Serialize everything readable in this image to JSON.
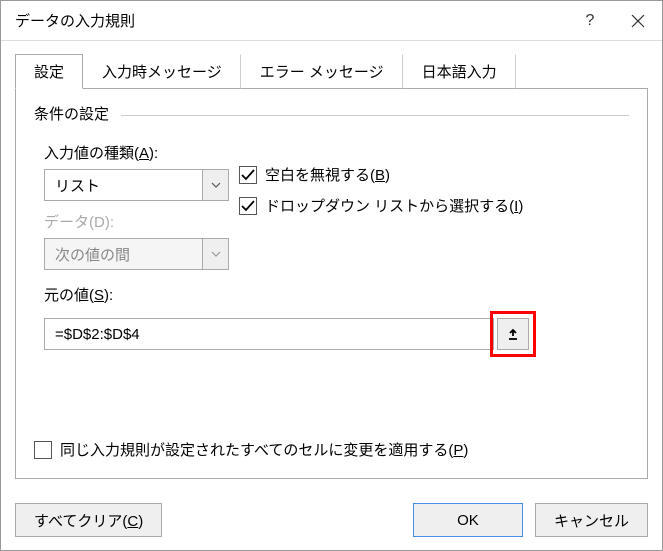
{
  "titlebar": {
    "title": "データの入力規則"
  },
  "tabs": {
    "settings": "設定",
    "input_msg": "入力時メッセージ",
    "error_msg": "エラー メッセージ",
    "ime": "日本語入力"
  },
  "fieldset": {
    "legend": "条件の設定"
  },
  "allow": {
    "label_pre": "入力値の種類(",
    "label_key": "A",
    "label_post": "):",
    "value": "リスト"
  },
  "data": {
    "label_pre": "データ(",
    "label_key": "D",
    "label_post": "):",
    "value": "次の値の間"
  },
  "ignore_blank": {
    "pre": "空白を無視する(",
    "key": "B",
    "post": ")"
  },
  "dropdown": {
    "pre": "ドロップダウン リストから選択する(",
    "key": "I",
    "post": ")"
  },
  "source": {
    "label_pre": "元の値(",
    "label_key": "S",
    "label_post": "):",
    "value": "=$D$2:$D$4"
  },
  "apply_all": {
    "pre": "同じ入力規則が設定されたすべてのセルに変更を適用する(",
    "key": "P",
    "post": ")"
  },
  "footer": {
    "clear_pre": "すべてクリア(",
    "clear_key": "C",
    "clear_post": ")",
    "ok": "OK",
    "cancel": "キャンセル"
  }
}
